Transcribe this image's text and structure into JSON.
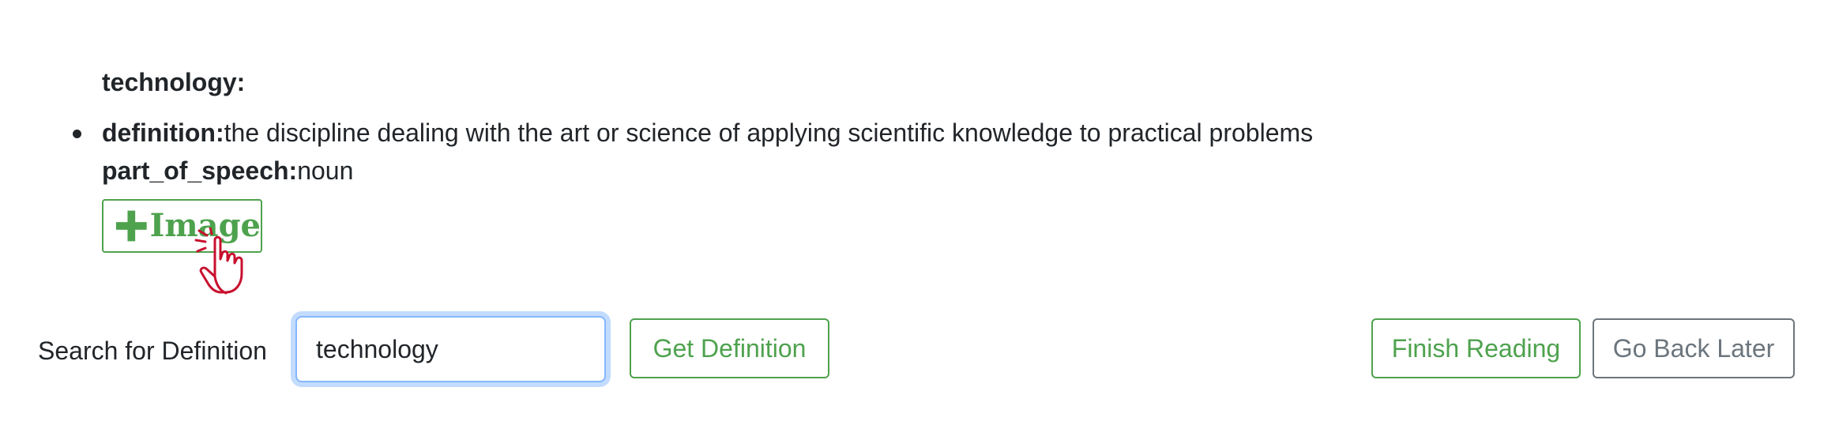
{
  "entry": {
    "word_heading": "technology:",
    "definitions": [
      {
        "definition_key": "definition:",
        "definition_value": "the discipline dealing with the art or science of applying scientific knowledge to practical problems",
        "pos_key": "part_of_speech:",
        "pos_value": "noun"
      }
    ]
  },
  "image_button": {
    "label": "Image",
    "icon": "plus-icon"
  },
  "cursor": {
    "icon": "hand-pointer-click-icon",
    "color": "#c8102e"
  },
  "search": {
    "label": "Search for Definition",
    "value": "technology",
    "placeholder": ""
  },
  "buttons": {
    "get_definition": "Get Definition",
    "finish_reading": "Finish Reading",
    "go_back_later": "Go Back Later"
  },
  "colors": {
    "success": "#4ea24e",
    "secondary": "#6c757d",
    "focus": "#86b7fe",
    "text": "#212529"
  }
}
